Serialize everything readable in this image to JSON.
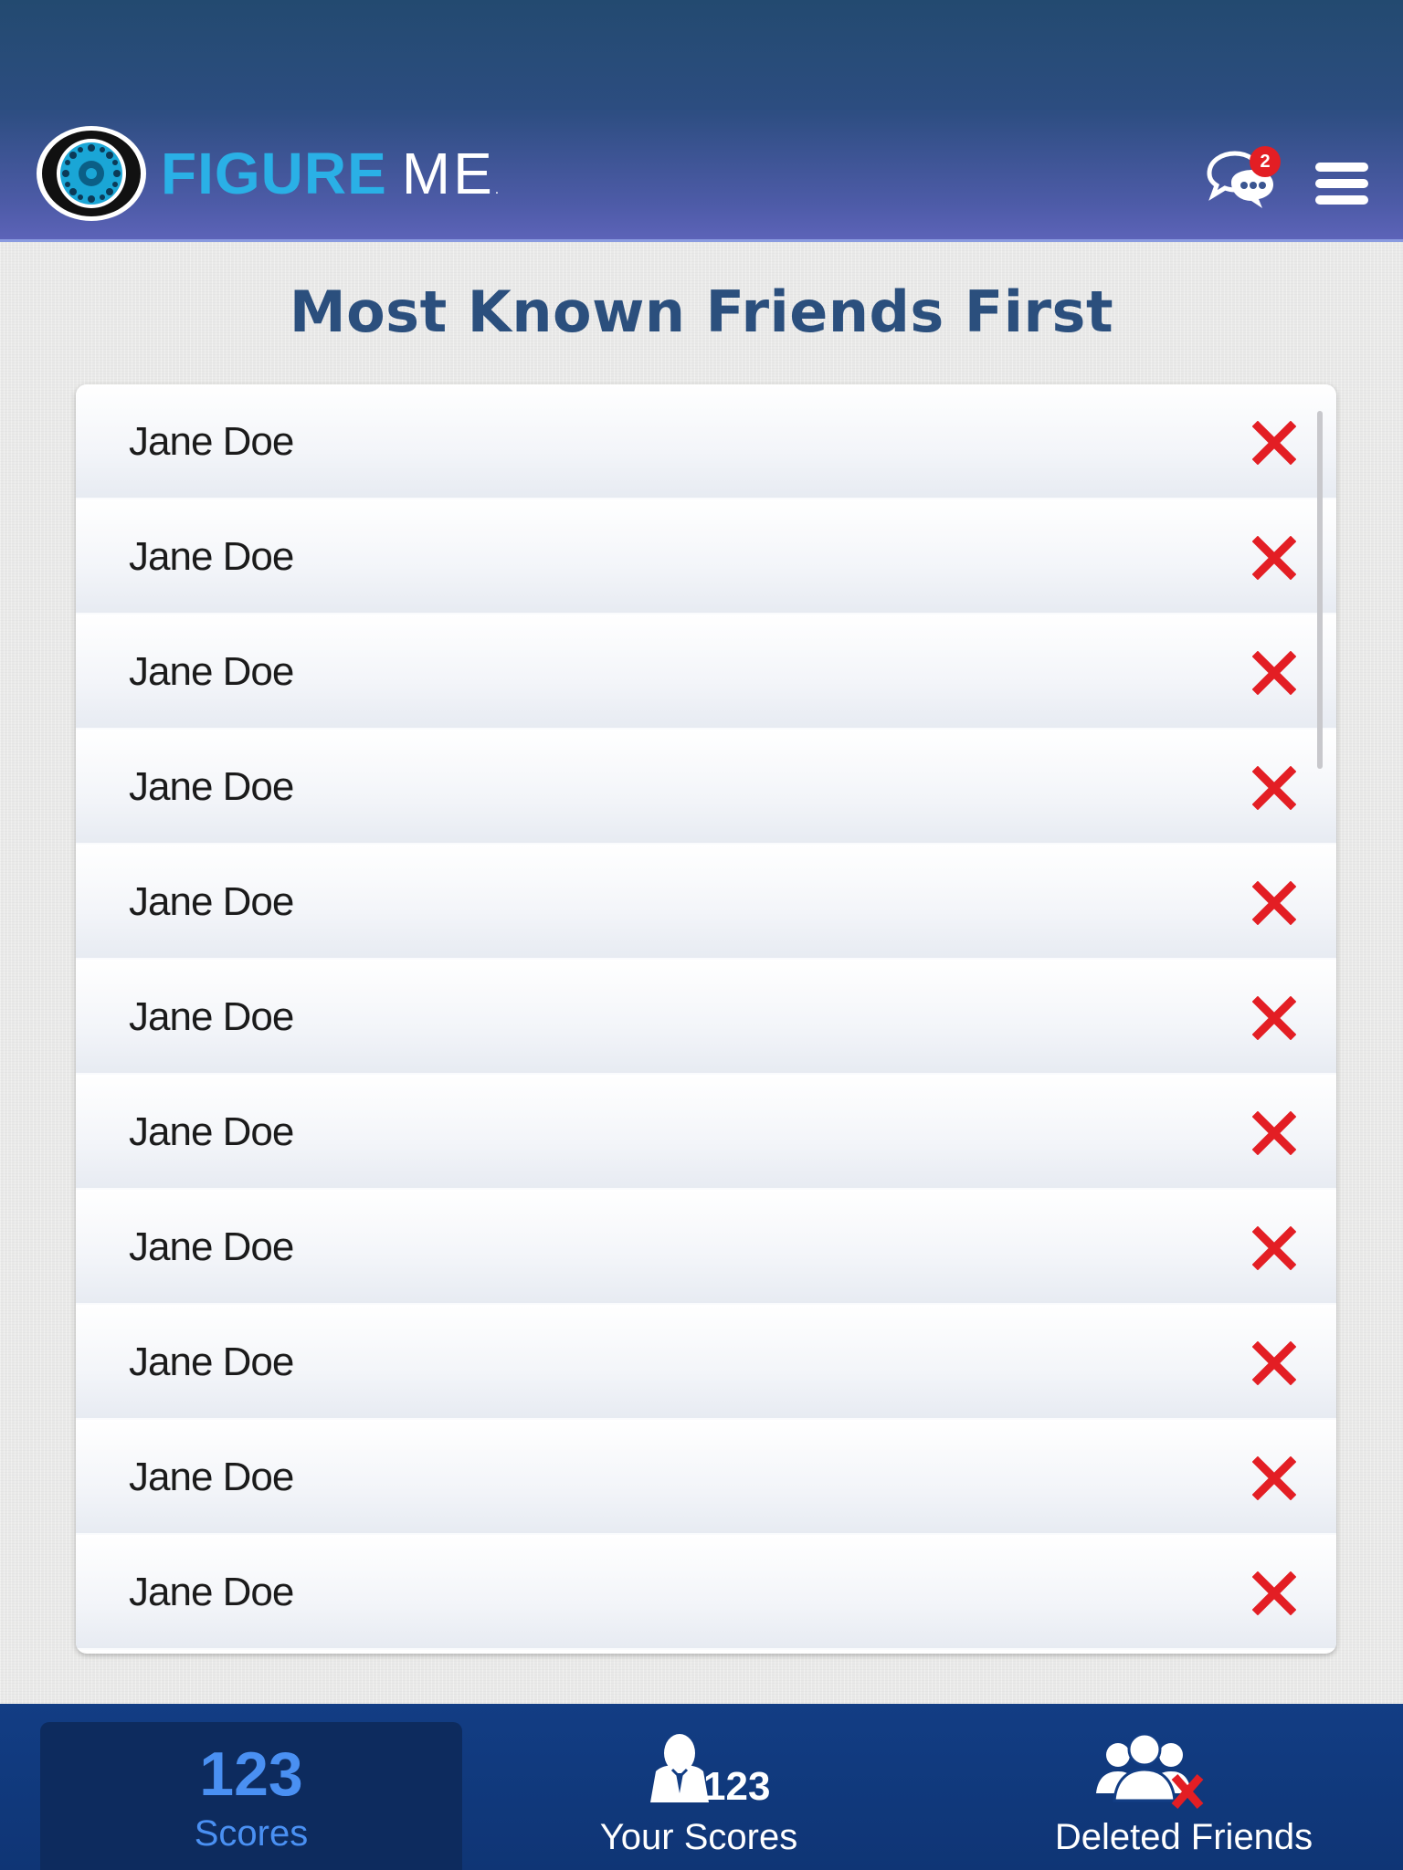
{
  "header": {
    "logo_figure": "FIGURE",
    "logo_me": "ME",
    "logo_reg": ".",
    "chat_badge_count": "2"
  },
  "page_title": "Most Known Friends First",
  "friends": [
    {
      "name": "Jane Doe"
    },
    {
      "name": "Jane Doe"
    },
    {
      "name": "Jane Doe"
    },
    {
      "name": "Jane Doe"
    },
    {
      "name": "Jane Doe"
    },
    {
      "name": "Jane Doe"
    },
    {
      "name": "Jane Doe"
    },
    {
      "name": "Jane Doe"
    },
    {
      "name": "Jane Doe"
    },
    {
      "name": "Jane Doe"
    },
    {
      "name": "Jane Doe"
    }
  ],
  "bottom_nav": {
    "scores_number": "123",
    "scores_label": "Scores",
    "your_scores_number": "123",
    "your_scores_label": "Your Scores",
    "deleted_friends_label": "Deleted Friends"
  },
  "colors": {
    "header_top": "#234a70",
    "header_bottom": "#5c63b8",
    "title": "#2b4f7d",
    "delete_red": "#e31e24",
    "nav_bg": "#123d84",
    "nav_active": "#0d2b5e",
    "active_text": "#4a90f2",
    "logo_blue": "#2ab0e6"
  },
  "icons": {
    "logo": "eye-logo-icon",
    "chat": "chat-bubbles-icon",
    "menu": "hamburger-menu-icon",
    "delete": "close-x-icon",
    "your_scores": "person-icon",
    "deleted_friends": "group-delete-icon"
  }
}
